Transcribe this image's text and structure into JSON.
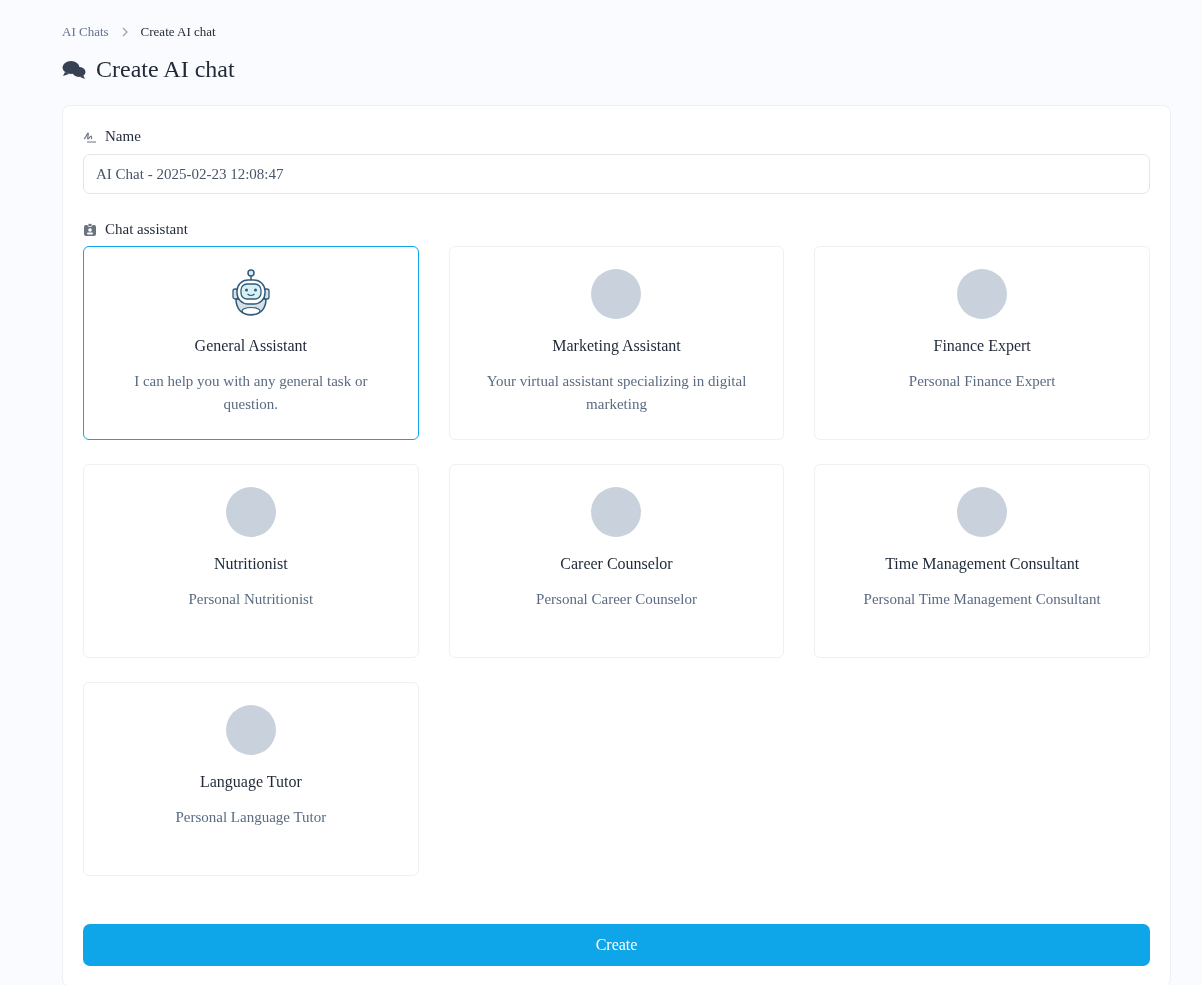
{
  "breadcrumb": [
    {
      "label": "AI Chats",
      "current": false
    },
    {
      "label": "Create AI chat",
      "current": true
    }
  ],
  "title": "Create AI chat",
  "name_field": {
    "label": "Name",
    "value": "AI Chat - 2025-02-23 12:08:47"
  },
  "assistant_label": "Chat assistant",
  "assistants": [
    {
      "kind": "robot",
      "name": "General Assistant",
      "description": "I can help you with any general task or question.",
      "selected": true
    },
    {
      "kind": "avatar",
      "name": "Marketing Assistant",
      "description": "Your virtual assistant specializing in digital marketing",
      "selected": false
    },
    {
      "kind": "avatar",
      "name": "Finance Expert",
      "description": "Personal Finance Expert",
      "selected": false
    },
    {
      "kind": "avatar",
      "name": "Nutritionist",
      "description": "Personal Nutritionist",
      "selected": false
    },
    {
      "kind": "avatar",
      "name": "Career Counselor",
      "description": "Personal Career Counselor",
      "selected": false
    },
    {
      "kind": "avatar",
      "name": "Time Management Consultant",
      "description": "Personal Time Management Consultant",
      "selected": false
    },
    {
      "kind": "avatar",
      "name": "Language Tutor",
      "description": "Personal Language Tutor",
      "selected": false
    }
  ],
  "create_button": "Create"
}
